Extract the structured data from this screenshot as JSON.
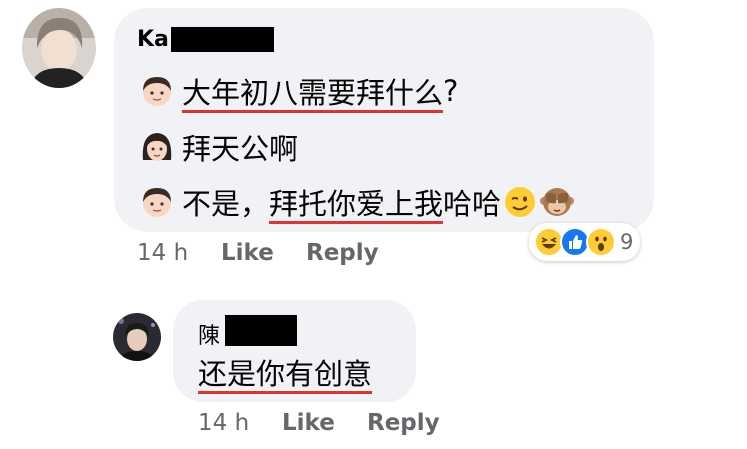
{
  "comments": [
    {
      "author_visible": "Ka",
      "lines": [
        {
          "emoji": "boy-face",
          "text": "大年初八需要拜什么",
          "tail": "?"
        },
        {
          "emoji": "woman-face",
          "text": "拜天公啊"
        },
        {
          "emoji": "boy-face",
          "pre": "不是，",
          "text": "拜托你爱上我",
          "tail": "哈哈",
          "extra_emojis": [
            "winking-face",
            "see-no-evil-monkey"
          ]
        }
      ],
      "time": "14 h",
      "like": "Like",
      "reply": "Reply",
      "reactions": {
        "icons": [
          "haha",
          "like",
          "wow"
        ],
        "count": "9"
      }
    },
    {
      "author_visible": "陳",
      "text": "还是你有创意",
      "time": "14 h",
      "like": "Like",
      "reply": "Reply"
    }
  ],
  "colors": {
    "bubble": "#f0f2f5",
    "meta_text": "#65676b",
    "underline": "#e0322f",
    "like_blue": "#1877f2",
    "emoji_yellow": "#ffcc33"
  }
}
